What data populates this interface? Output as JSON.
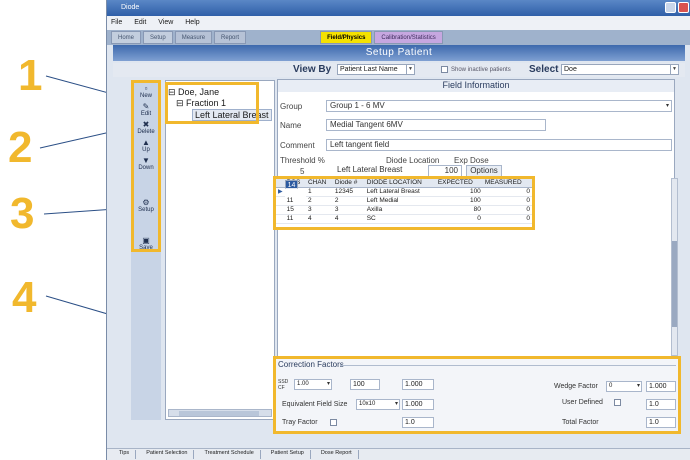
{
  "window": {
    "title": "Diode"
  },
  "menubar": [
    "File",
    "Edit",
    "View",
    "Help"
  ],
  "tabs": [
    {
      "label": "Home"
    },
    {
      "label": "Setup"
    },
    {
      "label": "Measure"
    },
    {
      "label": "Report"
    },
    {
      "label": "Field/Physics"
    },
    {
      "label": "Calibration/Statistics"
    }
  ],
  "active_tab": "Field/Physics",
  "banner": "Setup Patient",
  "view_by": {
    "label": "View By",
    "value": "Patient Last Name",
    "select_label": "Select",
    "select_value": "Doe",
    "checkbox_label": "Show inactive patients"
  },
  "toolbar": [
    {
      "label": "New",
      "icon": "new-icon"
    },
    {
      "label": "Edit",
      "icon": "edit-icon"
    },
    {
      "label": "Delete",
      "icon": "delete-icon"
    },
    {
      "label": "Up",
      "icon": "up-arrow-icon"
    },
    {
      "label": "Down",
      "icon": "down-arrow-icon"
    },
    {
      "label": "Setup",
      "icon": "setup-icon"
    },
    {
      "label": "Save",
      "icon": "save-icon"
    }
  ],
  "tree": {
    "patient": "Doe, Jane",
    "fraction": "Fraction 1",
    "leaf": "Left Lateral Breast"
  },
  "field_info": {
    "title": "Field Information",
    "group_label": "Group",
    "group_value": "Group 1 - 6 MV",
    "name_label": "Name",
    "name_value": "Medial Tangent 6MV",
    "comment_label": "Comment",
    "comment_value": "Left tangent field",
    "threshold_label": "Threshold %",
    "threshold_value": "5",
    "diode_location_label": "Diode Location",
    "diode_location_value": "Left Lateral Breast",
    "exp_dose_label": "Exp Dose",
    "exp_dose_value": "100",
    "options_label": "Options"
  },
  "grid": {
    "columns": [
      "POS",
      "CHAN",
      "Diode #",
      "DIODE LOCATION",
      "EXPECTED",
      "MEASURED"
    ],
    "rows": [
      [
        "14",
        "1",
        "12345",
        "Left Lateral Breast",
        "100",
        "0"
      ],
      [
        "11",
        "2",
        "2",
        "Left Medial",
        "100",
        "0"
      ],
      [
        "15",
        "3",
        "3",
        "Axilla",
        "80",
        "0"
      ],
      [
        "11",
        "4",
        "4",
        "SC",
        "0",
        "0"
      ]
    ]
  },
  "correction_factors": {
    "title": "Correction Factors",
    "ssd_label": "SSD CF",
    "ssd_value": "1.00",
    "ssd_field": "100",
    "ssd_cf_value": "1.000",
    "equiv_field_label": "Equivalent Field Size",
    "equiv_field_value": "10x10",
    "equiv_cf_value": "1.000",
    "tray_label": "Tray Factor",
    "tray_value": "1.0",
    "wedge_label": "Wedge Factor",
    "wedge_value": "0",
    "wedge_cf_value": "1.000",
    "user_defined_label": "User Defined",
    "user_defined_value": "1.0",
    "total_label": "Total Factor",
    "total_value": "1.0"
  },
  "statusbar": [
    "Tips",
    "Patient Selection",
    "Treatment Schedule",
    "Patient Setup",
    "Dose Report"
  ],
  "callouts": [
    "1",
    "2",
    "3",
    "4"
  ],
  "colors": {
    "highlight": "#f1b82d",
    "active_tab": "#f4e100",
    "banner": "#3d69ad"
  }
}
